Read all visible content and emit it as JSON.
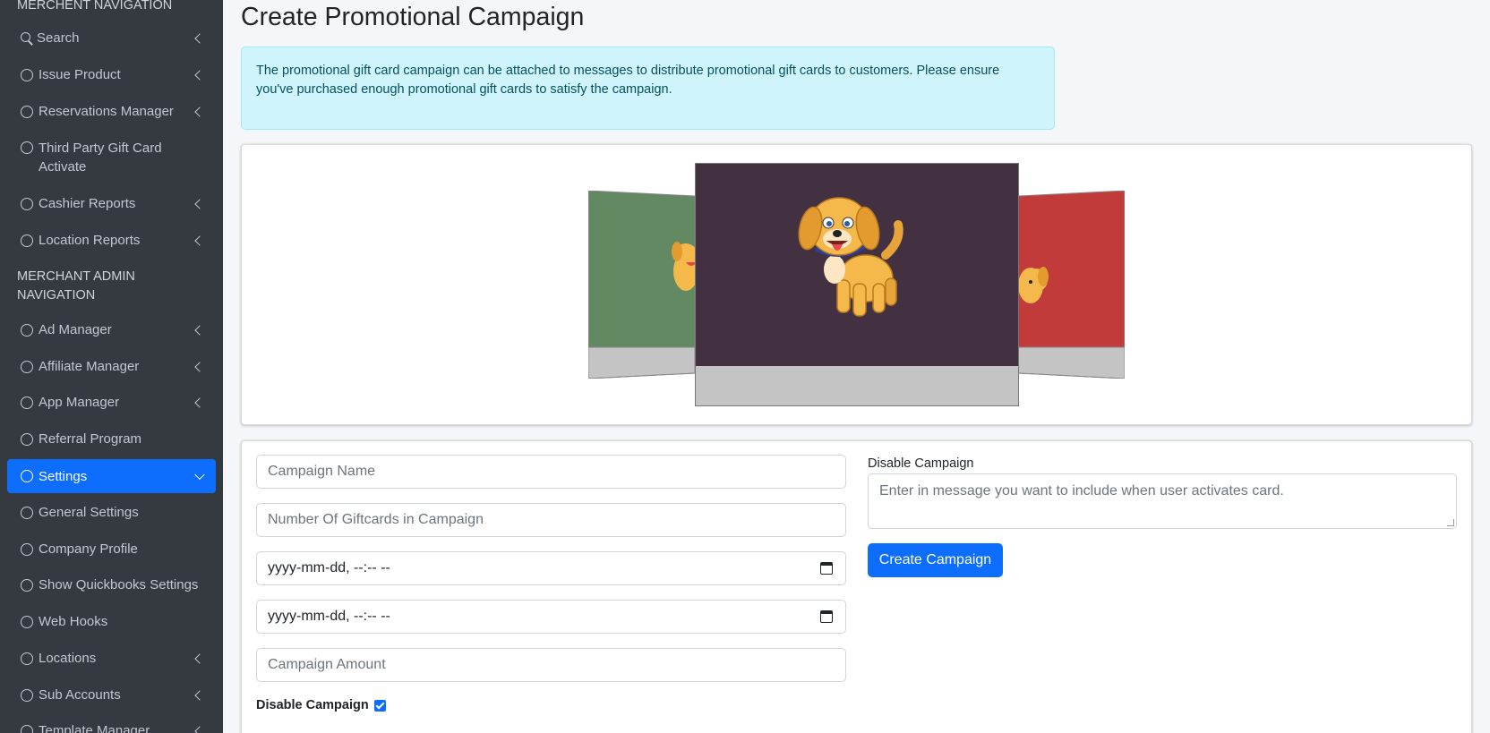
{
  "sidebar": {
    "header1": "MERCHENT NAVIGATION",
    "header2": "MERCHANT ADMIN NAVIGATION",
    "items": [
      {
        "label": "Search"
      },
      {
        "label": "Issue Product"
      },
      {
        "label": "Reservations Manager"
      },
      {
        "label": "Third Party Gift Card Activate"
      },
      {
        "label": "Cashier Reports"
      },
      {
        "label": "Location Reports"
      },
      {
        "label": "Ad Manager"
      },
      {
        "label": "Affiliate Manager"
      },
      {
        "label": "App Manager"
      },
      {
        "label": "Referral Program"
      },
      {
        "label": "Settings"
      },
      {
        "label": "General Settings"
      },
      {
        "label": "Company Profile"
      },
      {
        "label": "Show Quickbooks Settings"
      },
      {
        "label": "Web Hooks"
      },
      {
        "label": "Locations"
      },
      {
        "label": "Sub Accounts"
      },
      {
        "label": "Template Manager"
      }
    ]
  },
  "page": {
    "title": "Create Promotional Campaign",
    "info": "The promotional gift card campaign can be attached to messages to distribute promotional gift cards to customers. Please ensure you've purchased enough promotional gift cards to satisfy the campaign."
  },
  "carousel": {
    "left_color": "#628962",
    "center_color": "#433040",
    "right_color": "#c13b3b",
    "footer_color": "#c4c4c4"
  },
  "form": {
    "campaign_name_placeholder": "Campaign Name",
    "giftcard_count_placeholder": "Number Of Giftcards in Campaign",
    "start_datetime": "yyyy-mm-dd, --:-- --",
    "end_datetime": "yyyy-mm-dd, --:-- --",
    "amount_placeholder": "Campaign Amount",
    "disable_label_bottom": "Disable Campaign",
    "disable_label_top": "Disable Campaign",
    "message_placeholder": "Enter in message you want to include when user activates card.",
    "create_button": "Create Campaign"
  }
}
